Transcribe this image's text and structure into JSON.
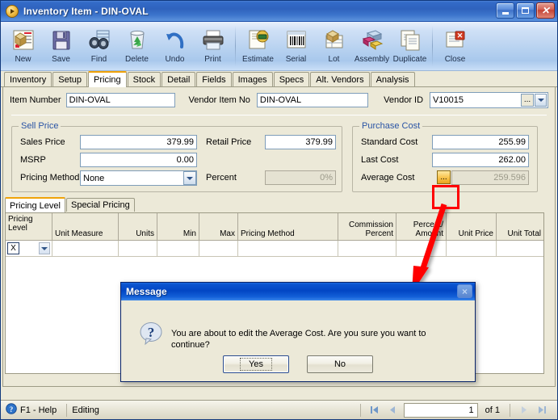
{
  "window": {
    "title": "Inventory Item - DIN-OVAL",
    "icon": "orange-arrow-icon",
    "minimize": "Minimize",
    "maximize": "Maximize",
    "close": "Close"
  },
  "toolbar": {
    "buttons": [
      {
        "label": "New",
        "icon": "new-item-icon"
      },
      {
        "label": "Save",
        "icon": "floppy-disk-icon"
      },
      {
        "label": "Find",
        "icon": "binoculars-icon"
      },
      {
        "label": "Delete",
        "icon": "recycle-bin-icon"
      },
      {
        "label": "Undo",
        "icon": "undo-arrow-icon"
      },
      {
        "label": "Print",
        "icon": "printer-icon"
      },
      {
        "label": "Estimate",
        "icon": "estimate-icon"
      },
      {
        "label": "Serial",
        "icon": "barcode-icon"
      },
      {
        "label": "Lot",
        "icon": "lot-icon"
      },
      {
        "label": "Assembly",
        "icon": "assembly-icon"
      },
      {
        "label": "Duplicate",
        "icon": "duplicate-icon"
      },
      {
        "label": "Close",
        "icon": "close-window-icon"
      }
    ]
  },
  "tabs": [
    {
      "label": "Inventory",
      "active": false
    },
    {
      "label": "Setup",
      "active": false
    },
    {
      "label": "Pricing",
      "active": true
    },
    {
      "label": "Stock",
      "active": false
    },
    {
      "label": "Detail",
      "active": false
    },
    {
      "label": "Fields",
      "active": false
    },
    {
      "label": "Images",
      "active": false
    },
    {
      "label": "Specs",
      "active": false
    },
    {
      "label": "Alt. Vendors",
      "active": false
    },
    {
      "label": "Analysis",
      "active": false
    }
  ],
  "header_fields": {
    "item_number_label": "Item Number",
    "item_number_value": "DIN-OVAL",
    "vendor_item_no_label": "Vendor Item No",
    "vendor_item_no_value": "DIN-OVAL",
    "vendor_id_label": "Vendor ID",
    "vendor_id_value": "V10015",
    "vendor_id_ellipsis": "...",
    "vendor_id_dropdown": "chevron-down-icon"
  },
  "sell_price": {
    "caption": "Sell Price",
    "sales_price_label": "Sales Price",
    "sales_price_value": "379.99",
    "retail_price_label": "Retail Price",
    "retail_price_value": "379.99",
    "msrp_label": "MSRP",
    "msrp_value": "0.00",
    "pricing_method_label": "Pricing Method",
    "pricing_method_value": "None",
    "pricing_method_options": [
      "None"
    ],
    "percent_label": "Percent",
    "percent_value": "0%"
  },
  "purchase_cost": {
    "caption": "Purchase Cost",
    "standard_cost_label": "Standard Cost",
    "standard_cost_value": "255.99",
    "last_cost_label": "Last Cost",
    "last_cost_value": "262.00",
    "average_cost_label": "Average Cost",
    "average_cost_value": "259.596",
    "average_cost_ellipsis": "..."
  },
  "inner_tabs": [
    {
      "label": "Pricing Level",
      "active": true
    },
    {
      "label": "Special Pricing",
      "active": false
    }
  ],
  "grid": {
    "columns": [
      "Pricing Level",
      "Unit Measure",
      "Units",
      "Min",
      "Max",
      "Pricing Method",
      "Commission Percent",
      "Percent/ Amount",
      "Unit Price",
      "Unit Total"
    ],
    "row": {
      "delete_button": "X",
      "dropdown": "chevron-down-icon",
      "cells": [
        "",
        "",
        "",
        "",
        "",
        "",
        "",
        "",
        ""
      ]
    }
  },
  "annotation": {
    "highlight": "red-box-around-average-cost-ellipsis",
    "arrow": "red-arrow-to-dialog",
    "color": "#ff0000"
  },
  "dialog": {
    "title": "Message",
    "icon": "question-icon",
    "message": "You are about to edit the Average Cost. Are you sure you want to continue?",
    "yes_label": "Yes",
    "no_label": "No",
    "close_label": "×"
  },
  "statusbar": {
    "help_icon": "help-icon",
    "help_label": "F1 - Help",
    "mode": "Editing",
    "first_icon": "first-record-icon",
    "prev_icon": "previous-record-icon",
    "page_value": "1",
    "of_label": "of  1",
    "next_icon": "next-record-icon",
    "last_icon": "last-record-icon"
  }
}
